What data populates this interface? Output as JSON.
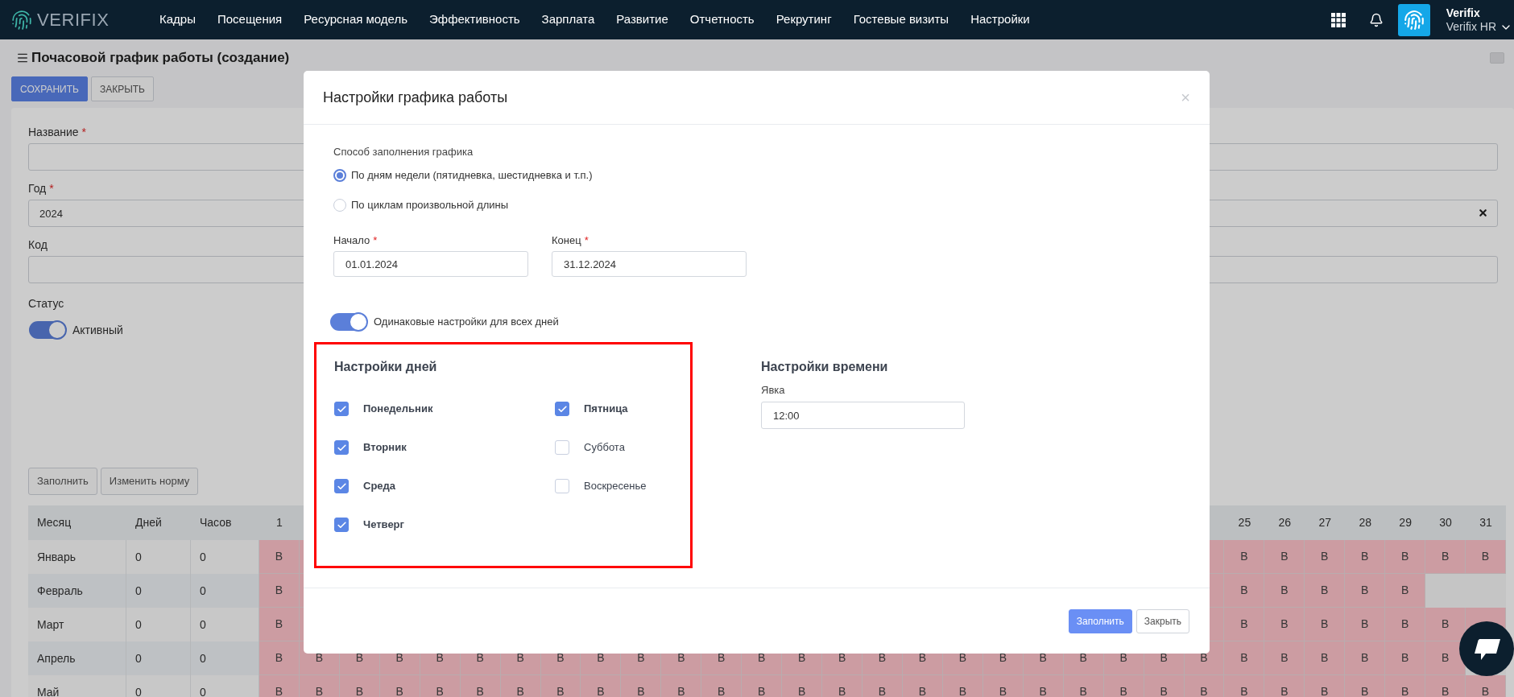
{
  "nav": {
    "logo": "VERIFIX",
    "items": [
      "Кадры",
      "Посещения",
      "Ресурсная модель",
      "Эффективность",
      "Зарплата",
      "Развитие",
      "Отчетность",
      "Рекрутинг",
      "Гостевые визиты",
      "Настройки"
    ],
    "user": {
      "name": "Verifix",
      "org": "Verifix HR"
    }
  },
  "page": {
    "title": "Почасовой график работы (создание)",
    "buttons": [
      {
        "label": "СОХРАНИТЬ",
        "kind": "primary"
      },
      {
        "label": "ЗАКРЫТЬ",
        "kind": "default"
      }
    ]
  },
  "form": {
    "fields": [
      {
        "label": "Название",
        "mark": "*",
        "clearable": false
      },
      {
        "label": "Год",
        "mark": "*",
        "value": "2024",
        "clearable": true
      },
      {
        "label": "Код",
        "clearable": false
      }
    ],
    "status": {
      "label": "Статус",
      "on": true,
      "text": "Активный"
    }
  },
  "table_actions": [
    "Заполнить",
    "Изменить норму"
  ],
  "table": {
    "columns": [
      "Месяц",
      "Дней",
      "Часов"
    ],
    "day_columns": [
      "1",
      null,
      null,
      null,
      null,
      null,
      null,
      null,
      null,
      null,
      null,
      null,
      null,
      null,
      null,
      null,
      null,
      null,
      null,
      null,
      null,
      null,
      null,
      null,
      "25",
      "26",
      "27",
      "28",
      "29",
      "30",
      "31"
    ],
    "rows": [
      {
        "month": "Январь",
        "days": "0",
        "hours": "0",
        "cells": [
          "В",
          null,
          null,
          null,
          null,
          null,
          null,
          null,
          null,
          null,
          null,
          null,
          null,
          null,
          null,
          null,
          null,
          null,
          null,
          null,
          null,
          null,
          null,
          null,
          "В",
          "В",
          "В",
          "В",
          "В",
          "В",
          "В"
        ]
      },
      {
        "month": "Февраль",
        "days": "0",
        "hours": "0",
        "cells": [
          "В",
          null,
          null,
          null,
          null,
          null,
          null,
          null,
          null,
          null,
          null,
          null,
          null,
          null,
          null,
          null,
          null,
          null,
          null,
          null,
          null,
          null,
          null,
          null,
          "В",
          "В",
          "В",
          "В",
          "В"
        ]
      },
      {
        "month": "Март",
        "days": "0",
        "hours": "0",
        "cells": [
          "В",
          null,
          null,
          null,
          null,
          null,
          null,
          null,
          null,
          null,
          null,
          null,
          null,
          null,
          null,
          null,
          null,
          null,
          null,
          null,
          null,
          null,
          null,
          null,
          "В",
          "В",
          "В",
          "В",
          "В",
          "В",
          null
        ]
      },
      {
        "month": "Апрель",
        "days": "0",
        "hours": "0",
        "cells": [
          "В",
          "В",
          "В",
          "В",
          "В",
          "В",
          "В",
          "В",
          "В",
          "В",
          "В",
          "В",
          "В",
          "В",
          "В",
          "В",
          "В",
          "В",
          "В",
          "В",
          "В",
          "В",
          "В",
          "В",
          "В",
          "В",
          "В",
          "В",
          "В",
          "В"
        ]
      },
      {
        "month": "Май",
        "days": "0",
        "hours": "0",
        "cells": [
          "В",
          "В",
          "В",
          "В",
          "В",
          "В",
          "В",
          "В",
          "В",
          "В",
          "В",
          "В",
          "В",
          "В",
          "В",
          "В",
          "В",
          "В",
          "В",
          "В",
          "В",
          "В",
          "В",
          "В",
          "В",
          "В",
          "В",
          "В",
          "В",
          "В",
          "В"
        ]
      }
    ]
  },
  "dialog": {
    "title": "Настройки графика работы",
    "close": "×",
    "fill_method": {
      "label": "Способ заполнения графика",
      "options": [
        {
          "label": "По дням недели (пятидневка, шестидневка и т.п.)",
          "selected": true
        },
        {
          "label": "По циклам произвольной длины",
          "selected": false
        }
      ]
    },
    "dates": [
      {
        "label": "Начало",
        "mark": "*",
        "value": "01.01.2024"
      },
      {
        "label": "Конец",
        "mark": "*",
        "value": "31.12.2024"
      }
    ],
    "same_settings": {
      "on": true,
      "label": "Одинаковые настройки для всех дней"
    },
    "days": {
      "title": "Настройки дней",
      "items": [
        {
          "label": "Понедельник",
          "checked": true
        },
        {
          "label": "Вторник",
          "checked": true
        },
        {
          "label": "Среда",
          "checked": true
        },
        {
          "label": "Четверг",
          "checked": true
        },
        {
          "label": "Пятница",
          "checked": true
        },
        {
          "label": "Суббота",
          "checked": false
        },
        {
          "label": "Воскресенье",
          "checked": false
        }
      ]
    },
    "time": {
      "title": "Настройки времени",
      "label": "Явка",
      "value": "12:00"
    },
    "buttons": [
      {
        "label": "Заполнить",
        "kind": "primary"
      },
      {
        "label": "Закрыть",
        "kind": "default"
      }
    ]
  }
}
